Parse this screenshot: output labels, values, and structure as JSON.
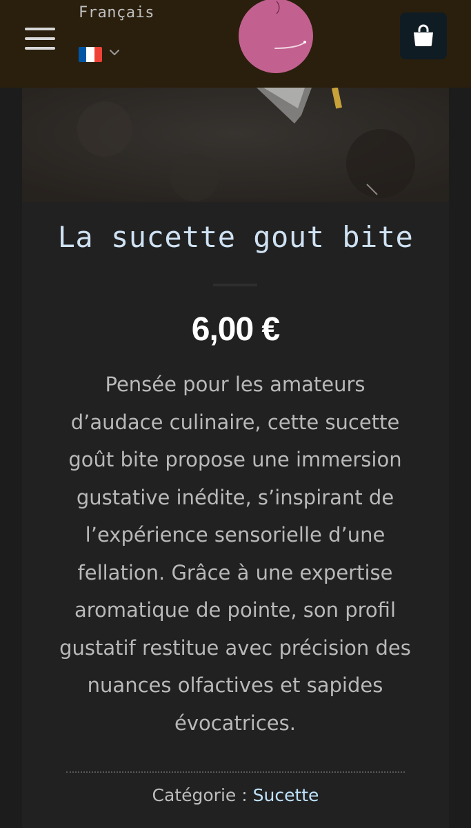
{
  "header": {
    "language_label": "Français",
    "flag_colors": [
      "#0055a4",
      "#ffffff",
      "#ef4135"
    ],
    "menu_icon": "hamburger-icon",
    "chevron_icon": "chevron-down-icon",
    "cart_icon": "shopping-bag-icon",
    "logo_color": "#c2618f"
  },
  "product": {
    "title": "La sucette gout bite",
    "price": "6,00 €",
    "description": "Pensée pour les amateurs d’audace culinaire, cette sucette goût bite propose une immersion gustative inédite, s’inspirant de l’expérience sensorielle d’une fellation. Grâce à une expertise aromatique de pointe, son profil gustatif restitue avec précision des nuances olfactives et sapides évocatrices.",
    "category_label": "Catégorie :",
    "category_link": "Sucette"
  },
  "colors": {
    "header_bg": "#2a1f0d",
    "page_bg": "#1c1c1c",
    "card_bg": "#212121",
    "title_color": "#cfe2f3",
    "link_color": "#bfe3ff",
    "cart_bg": "#0f1c24"
  }
}
